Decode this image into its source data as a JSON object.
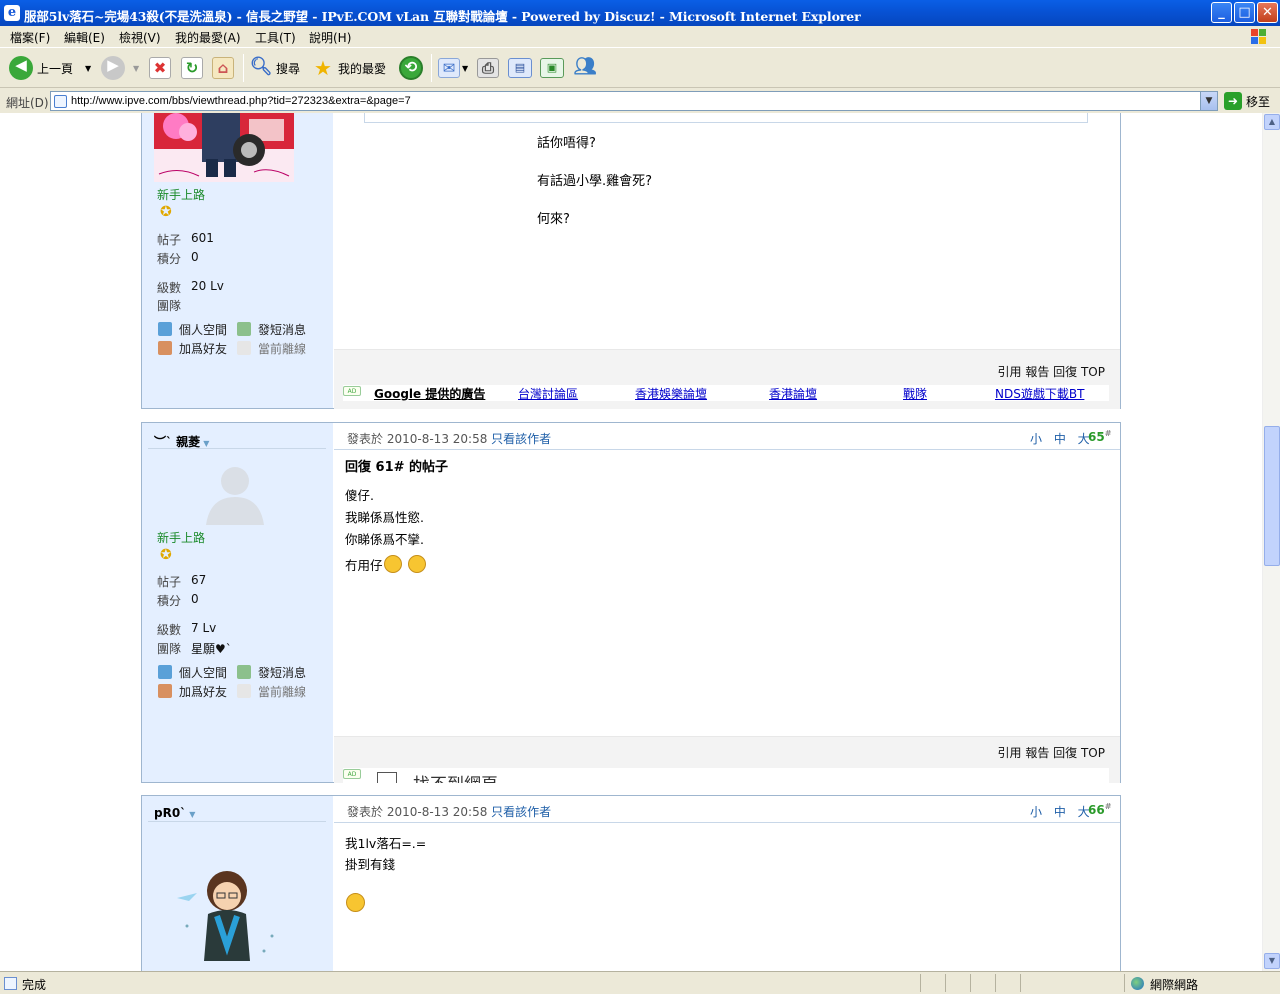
{
  "window": {
    "title": "服部5lv落石~完場43殺(不是洗溫泉) - 信長之野望 - IPvE.COM vLan 互聯對戰論壇 - Powered by Discuz! - Microsoft Internet Explorer",
    "min": "_",
    "max": "□",
    "close": "✕"
  },
  "menu": [
    "檔案(F)",
    "編輯(E)",
    "檢視(V)",
    "我的最愛(A)",
    "工具(T)",
    "說明(H)"
  ],
  "toolbar": {
    "back": "上一頁",
    "search": "搜尋",
    "favorites": "我的最愛"
  },
  "address": {
    "label": "網址(D)",
    "url": "http://www.ipve.com/bbs/viewthread.php?tid=272323&extra=&page=7",
    "go": "移至"
  },
  "status": {
    "text": "完成",
    "zone": "網際網路"
  },
  "labels": {
    "posts": "帖子",
    "points": "積分",
    "level": "級數",
    "team": "團隊",
    "space": "個人空間",
    "sms": "發短消息",
    "addfriend": "加爲好友",
    "offline": "當前離線",
    "reply_actions": "引用 報告 回復 TOP",
    "size": "小 中 大",
    "posted_at": "發表於",
    "only_author": "只看該作者",
    "floor_mark": "#"
  },
  "ads": {
    "google": "Google 提供的廣告",
    "links": [
      "台灣討論區",
      "香港娛樂論壇",
      "香港論壇",
      "戰隊",
      "NDS遊戲下載BT"
    ],
    "not_found": "找不到網頁",
    "tag": "AD"
  },
  "posts": [
    {
      "rank": "新手上路",
      "posts": "601",
      "points": "0",
      "level": "20 Lv",
      "team": "",
      "body": [
        "話你唔得?",
        "有話過小學.雞會死?",
        "何來?"
      ]
    },
    {
      "username": "︶ˋ 親菱",
      "rank": "新手上路",
      "posts": "67",
      "points": "0",
      "level": "7 Lv",
      "team": "星願♥ˋ",
      "date": "2010-8-13 20:58",
      "floor": "65",
      "heading": "回復 61# 的帖子",
      "body": [
        "傻仔.",
        "我睇係爲性慾.",
        "你睇係爲不攣.",
        "冇用仔"
      ]
    },
    {
      "username": "pR0ˋ",
      "date": "2010-8-13 20:58",
      "floor": "66",
      "body": [
        "我1lv落石=.=",
        "掛到有錢"
      ]
    }
  ]
}
